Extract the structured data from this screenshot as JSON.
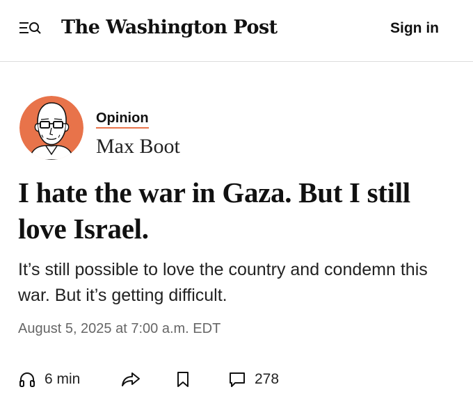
{
  "header": {
    "masthead": "The Washington Post",
    "sign_in_label": "Sign in",
    "menu_icon": "menu-search-icon"
  },
  "article": {
    "section": "Opinion",
    "author": "Max Boot",
    "headline": "I hate the war in Gaza. But I still love Israel.",
    "dek": "It’s still possible to love the country and condemn this war. But it’s getting difficult.",
    "dateline": "August 5, 2025 at 7:00 a.m. EDT"
  },
  "actions": {
    "listen_label": "6 min",
    "comments_count": "278",
    "icons": [
      "headphones-icon",
      "share-icon",
      "bookmark-icon",
      "comment-icon"
    ]
  },
  "colors": {
    "accent": "#e8734a",
    "text": "#111111",
    "muted": "#666666",
    "divider": "#dcdcdc"
  }
}
